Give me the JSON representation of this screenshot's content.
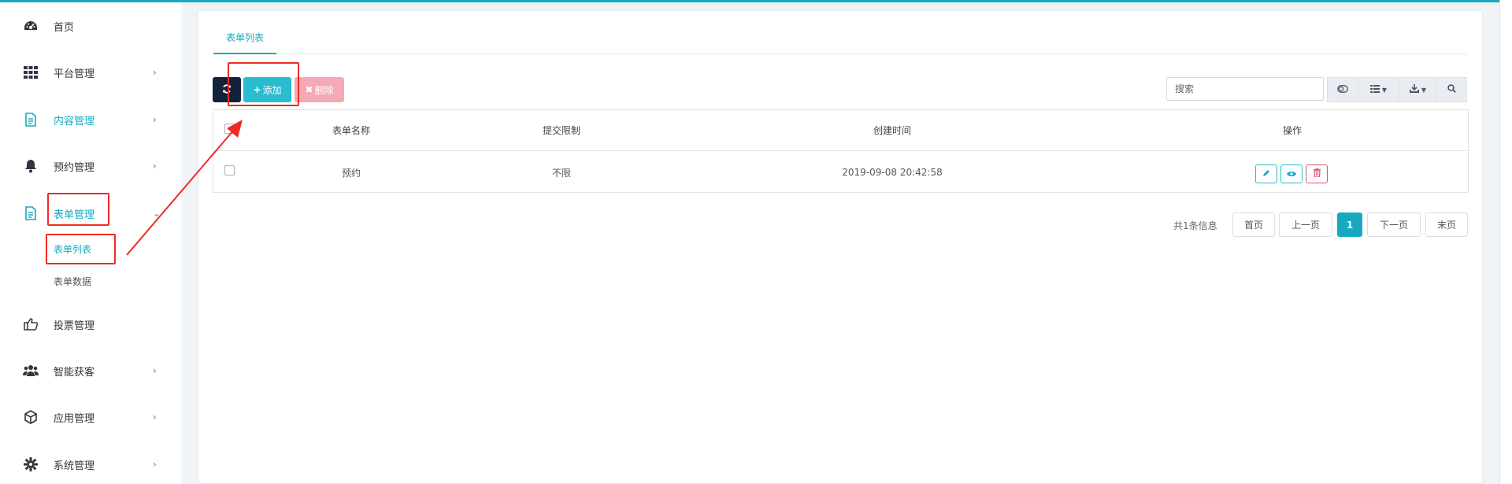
{
  "sidebar": {
    "items": [
      {
        "label": "首页",
        "icon": "dashboard-icon",
        "arrow": ""
      },
      {
        "label": "平台管理",
        "icon": "grid-icon",
        "arrow": "›"
      },
      {
        "label": "内容管理",
        "icon": "document-icon",
        "arrow": "›"
      },
      {
        "label": "预约管理",
        "icon": "bell-icon",
        "arrow": "›"
      },
      {
        "label": "表单管理",
        "icon": "form-icon",
        "arrow": "⌄"
      },
      {
        "label": "投票管理",
        "icon": "thumb-icon",
        "arrow": ""
      },
      {
        "label": "智能获客",
        "icon": "users-icon",
        "arrow": "›"
      },
      {
        "label": "应用管理",
        "icon": "cube-icon",
        "arrow": "›"
      },
      {
        "label": "系统管理",
        "icon": "gear-icon",
        "arrow": "›"
      }
    ],
    "sub_items": [
      {
        "label": "表单列表"
      },
      {
        "label": "表单数据"
      }
    ]
  },
  "tabs": [
    {
      "label": "表单列表"
    }
  ],
  "toolbar": {
    "refresh_icon": "refresh-icon",
    "add_label": "添加",
    "delete_label": "删除",
    "search_placeholder": "搜索"
  },
  "table": {
    "columns": [
      "表单名称",
      "提交限制",
      "创建时间",
      "操作"
    ],
    "rows": [
      {
        "name": "预约",
        "limit": "不限",
        "created": "2019-09-08 20:42:58"
      }
    ]
  },
  "pagination": {
    "info": "共1条信息",
    "first": "首页",
    "prev": "上一页",
    "current": "1",
    "next": "下一页",
    "last": "末页"
  },
  "colors": {
    "accent": "#17a9bf",
    "annotation": "#ee2a24",
    "danger": "#e05170"
  }
}
